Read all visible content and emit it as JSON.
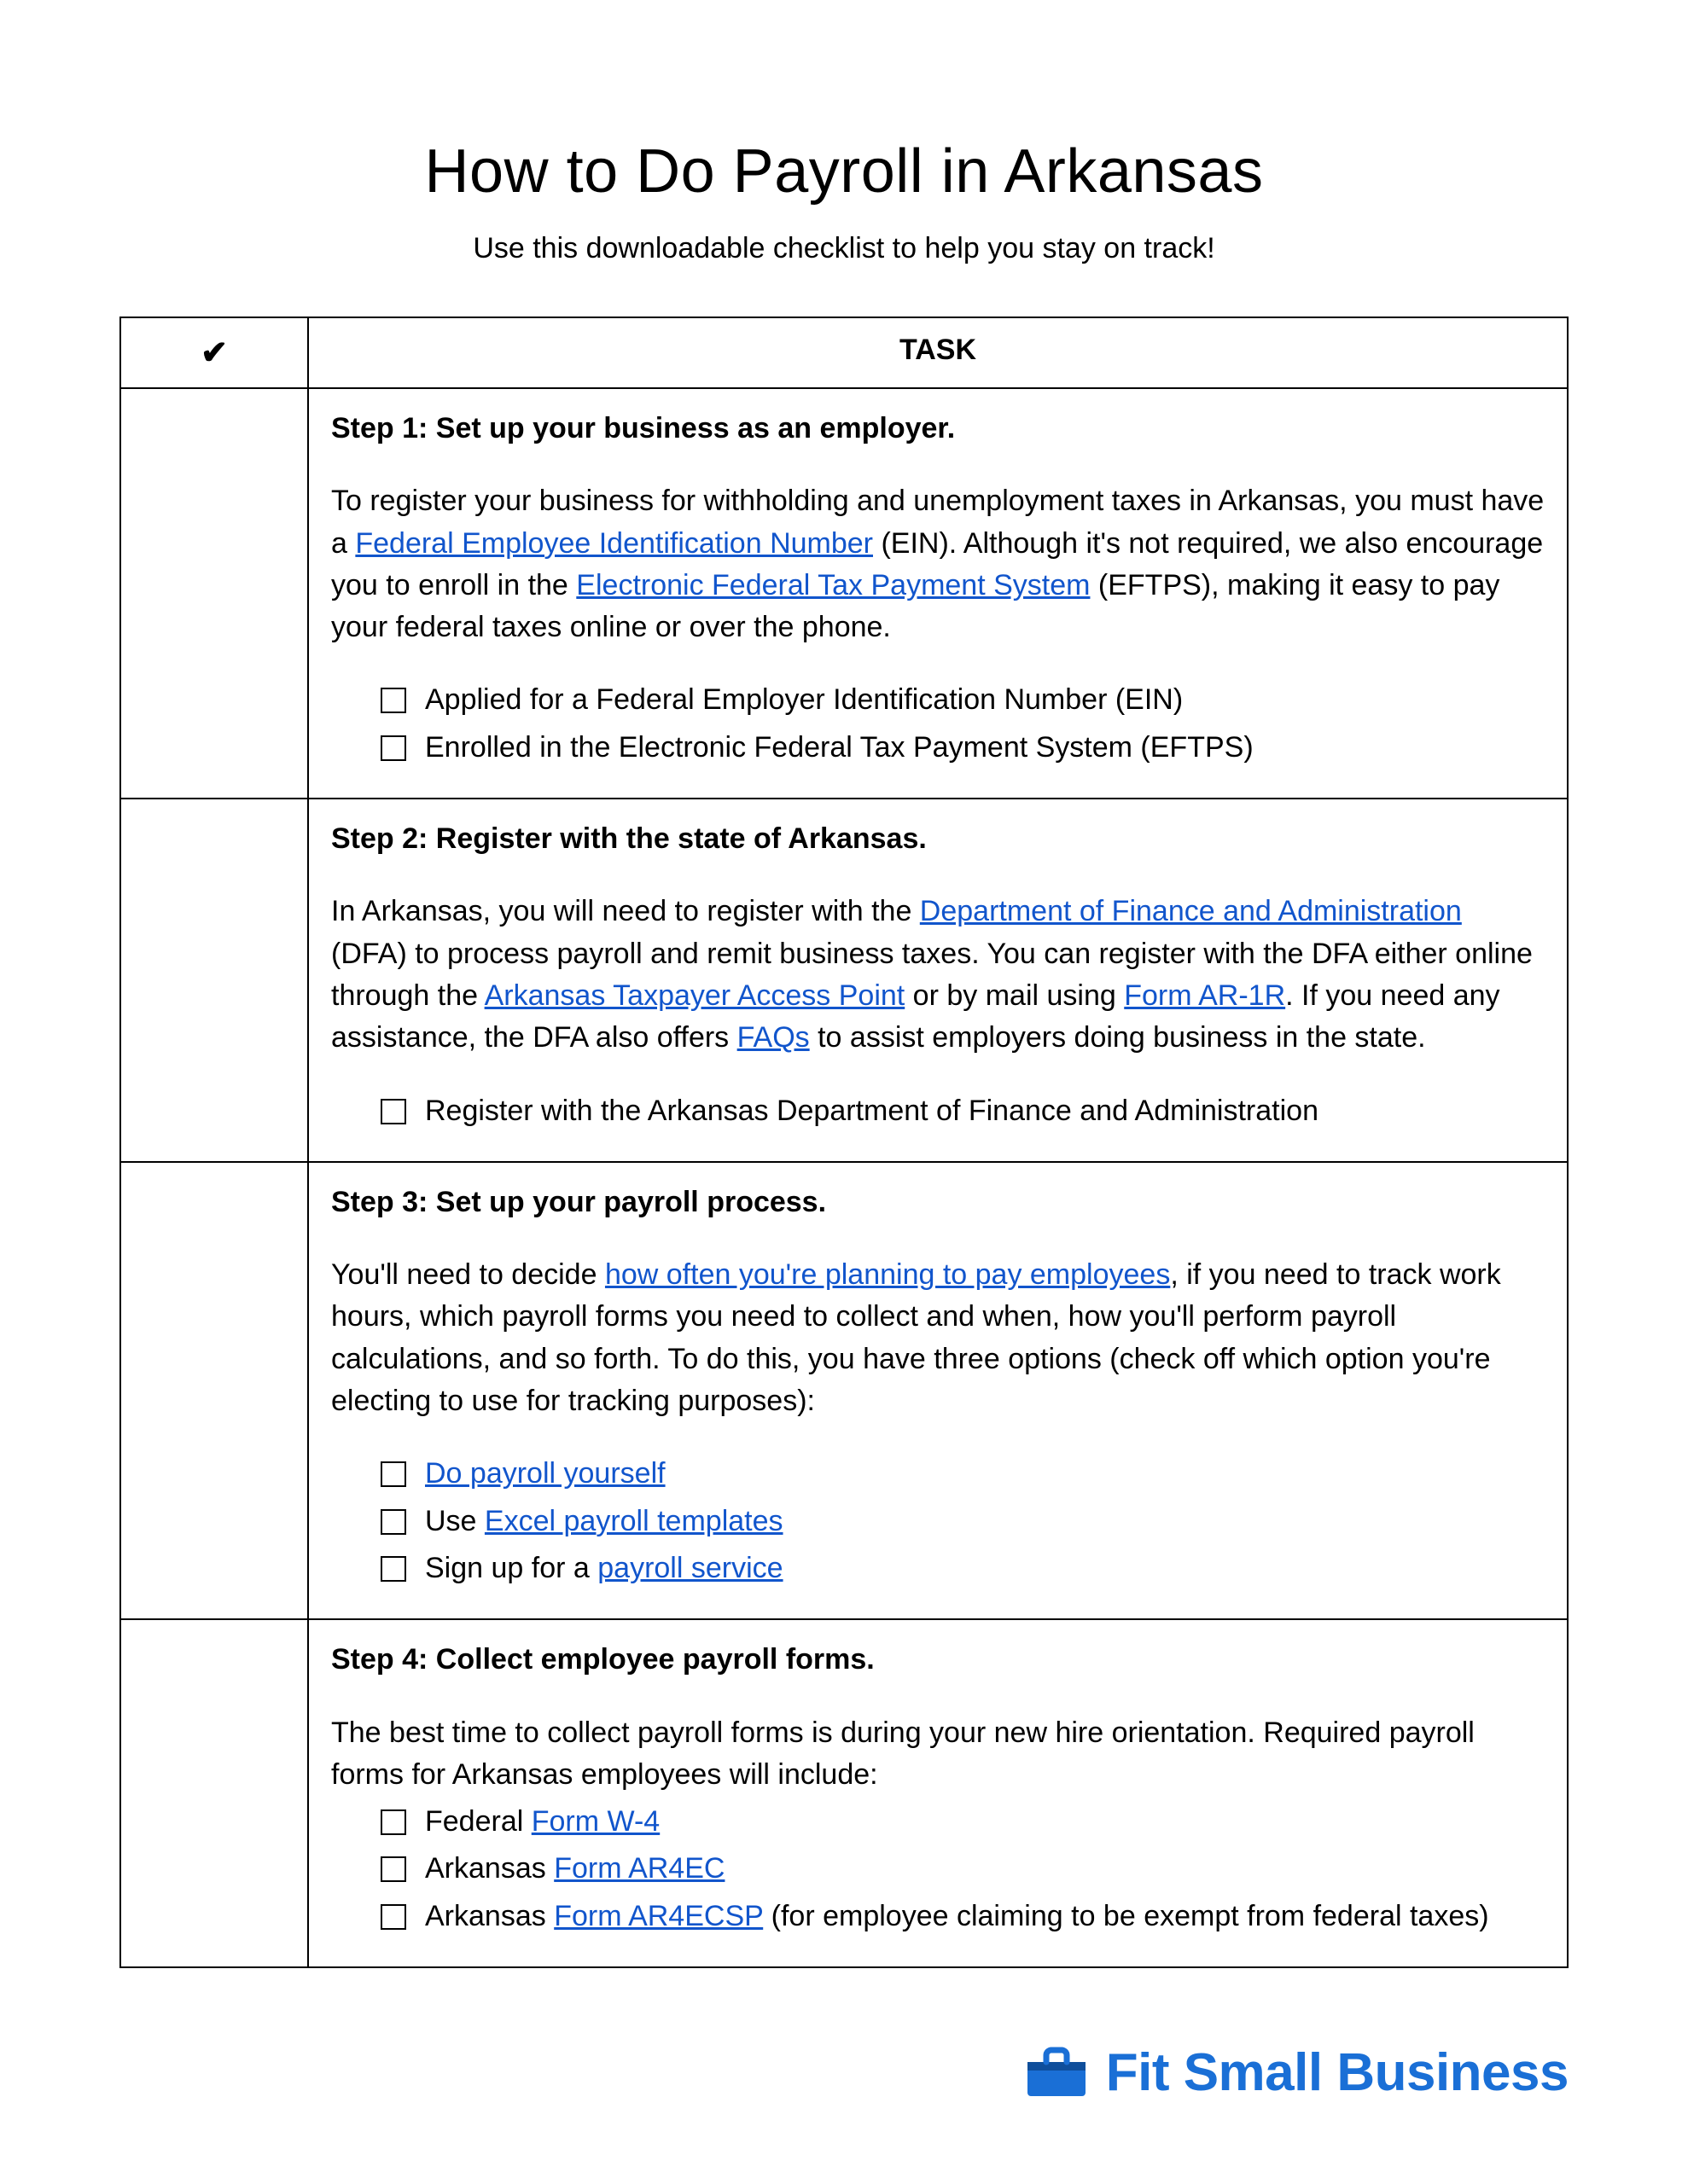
{
  "title": "How to Do Payroll in Arkansas",
  "subtitle": "Use this downloadable checklist to help you stay on track!",
  "table": {
    "check_header": "✔",
    "task_header": "TASK"
  },
  "steps": [
    {
      "title": "Step 1: Set up your business as an employer.",
      "body_html": "To register your business for withholding and unemployment taxes in Arkansas, you must have a {link:Federal Employee Identification Number} (EIN). Although it's not required, we also encourage you to enroll in the {link:Electronic Federal Tax Payment System} (EFTPS), making it easy to pay your federal taxes online or over the phone.",
      "checks": [
        "Applied for a Federal Employer Identification Number (EIN)",
        "Enrolled in the Electronic Federal Tax Payment System (EFTPS)"
      ]
    },
    {
      "title": "Step 2: Register with the state of Arkansas.",
      "body_html": "In Arkansas, you will need to register with the {link:Department of Finance and Administration} (DFA) to process payroll and remit business taxes. You can register with the DFA either online through the {link:Arkansas Taxpayer Access Point} or by mail using {link:Form AR-1R}. If you need any assistance, the DFA also offers {link:FAQs} to assist employers doing business in the state.",
      "checks": [
        "Register with the Arkansas Department of Finance and Administration"
      ]
    },
    {
      "title": "Step 3: Set up your payroll process.",
      "body_html": "You'll need to decide {link:how often you're planning to pay employees}, if you need to track work hours, which payroll forms you need to collect and when, how you'll perform payroll calculations, and so forth. To do this, you have three options (check off which option you're electing to use for tracking purposes):",
      "checks_html": [
        "{link:Do payroll yourself}",
        "Use {link:Excel payroll templates}",
        "Sign up for a {link:payroll service}"
      ]
    },
    {
      "title": "Step 4: Collect employee payroll forms.",
      "body_html_nogap": "The best time to collect payroll forms is during your new hire orientation. Required payroll forms for Arkansas employees will include:",
      "checks_html": [
        "Federal {link:Form W-4}",
        "Arkansas {link:Form AR4EC}",
        "Arkansas {link:Form AR4ECSP} (for employee claiming to be exempt from federal taxes)"
      ]
    }
  ],
  "footer": {
    "brand": "Fit Small Business"
  }
}
